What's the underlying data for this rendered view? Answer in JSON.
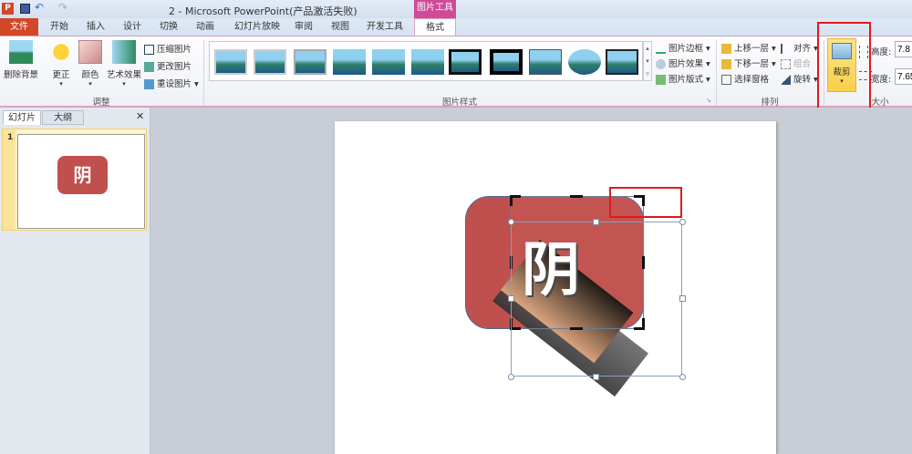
{
  "title": "2  -  Microsoft PowerPoint(产品激活失败)",
  "context_tab": "图片工具",
  "tabs": [
    "文件",
    "开始",
    "插入",
    "设计",
    "切换",
    "动画",
    "幻灯片放映",
    "审阅",
    "视图",
    "开发工具",
    "格式"
  ],
  "adjust": {
    "remove_bg": "删除背景",
    "corrections": "更正",
    "color": "颜色",
    "artistic": "艺术效果",
    "compress": "压缩图片",
    "change": "更改图片",
    "reset": "重设图片",
    "group": "调整"
  },
  "styles": {
    "border": "图片边框",
    "effects": "图片效果",
    "layout": "图片版式",
    "group": "图片样式"
  },
  "arrange": {
    "forward": "上移一层",
    "backward": "下移一层",
    "pane": "选择窗格",
    "align": "对齐",
    "group_btn": "组合",
    "rotate": "旋转",
    "group": "排列"
  },
  "size": {
    "crop": "裁剪",
    "height_label": "高度:",
    "height": "7.8",
    "width_label": "宽度:",
    "width": "7.65",
    "group": "大小"
  },
  "pane": {
    "tab_slides": "幻灯片",
    "tab_outline": "大纲",
    "close": "✕",
    "slide_number": "1"
  },
  "slide": {
    "glyph": "阴"
  },
  "colors": {
    "accent": "#c0504d",
    "file_tab": "#d24726",
    "highlight": "#e0191e",
    "context": "#d04a9a"
  }
}
